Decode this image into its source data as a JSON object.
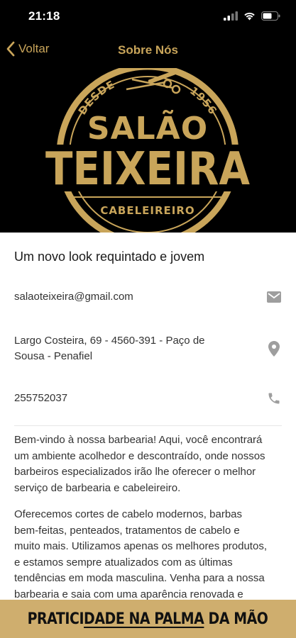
{
  "status_bar": {
    "time": "21:18",
    "icons": [
      "signal-icon",
      "wifi-icon",
      "battery-icon"
    ]
  },
  "nav": {
    "back_label": "Voltar",
    "title": "Sobre Nós"
  },
  "logo": {
    "arc_left": "DESDE",
    "arc_right": "1956",
    "line1": "SALÃO",
    "line2": "TEIXEIRA",
    "bottom": "CABELEIREIRO"
  },
  "about": {
    "tagline": "Um novo look requintado e jovem",
    "email": "salaoteixeira@gmail.com",
    "address_line1": "Largo Costeira, 69 - 4560-391 - Paço de",
    "address_line2": "Sousa - Penafiel",
    "phone": "255752037",
    "paragraph1": [
      "Bem-vindo à nossa barbearia! Aqui, você encontrará",
      "um ambiente acolhedor e descontraído, onde nossos",
      "barbeiros especializados irão lhe oferecer o melhor",
      "serviço de barbearia e cabeleireiro."
    ],
    "paragraph2": [
      "Oferecemos cortes de cabelo modernos, barbas",
      "bem-feitas, penteados, tratamentos de cabelo e",
      "muito mais. Utilizamos apenas os melhores produtos,",
      "e estamos sempre atualizados com as últimas",
      "tendências em moda masculina. Venha para a nossa",
      "barbearia e saia com uma aparência renovada e"
    ]
  },
  "banner": {
    "part1": "PRATICI",
    "part2": "DADE NA PALMA",
    "part3": " DA MÃO"
  },
  "colors": {
    "accent": "#c9a55a",
    "banner": "#cfae6e",
    "dark": "#000000",
    "icon_gray": "#9e9e9e"
  }
}
